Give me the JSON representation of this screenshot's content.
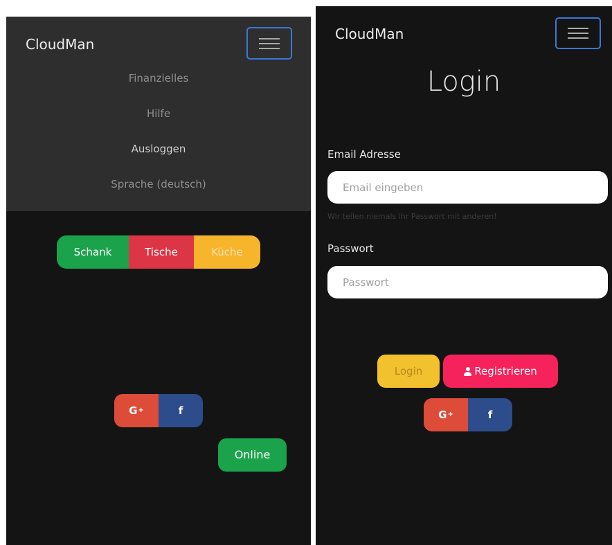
{
  "left_screen": {
    "navbar": {
      "brand": "CloudMan",
      "menu_items": [
        {
          "label": "Finanzielles",
          "active": false
        },
        {
          "label": "Hilfe",
          "active": false
        },
        {
          "label": "Ausloggen",
          "active": true
        },
        {
          "label": "Sprache (deutsch)",
          "active": false
        }
      ],
      "toggler_icon": "hamburger-icon"
    },
    "segmented_buttons": [
      {
        "label": "Schank",
        "color": "#1aa34a"
      },
      {
        "label": "Tische",
        "color": "#dc3545"
      },
      {
        "label": "Küche",
        "color": "#f7b52b"
      }
    ],
    "social": {
      "google_plus_label": "G",
      "google_plus_suffix": "+",
      "facebook_label": "f"
    },
    "online_button": {
      "label": "Online",
      "color": "#1aa34a"
    }
  },
  "right_screen": {
    "navbar": {
      "brand": "CloudMan",
      "toggler_icon": "hamburger-icon"
    },
    "title": "Login",
    "email": {
      "label": "Email Adresse",
      "placeholder": "Email eingeben",
      "value": "",
      "help": "Wir teilen niemals ihr Passwort mit anderen!"
    },
    "password": {
      "label": "Passwort",
      "placeholder": "Passwort",
      "value": ""
    },
    "login_button": {
      "label": "Login",
      "color": "#f2c12e"
    },
    "register_button": {
      "label": "Registrieren",
      "icon": "user-icon",
      "color": "#f5225b"
    },
    "social": {
      "google_plus_label": "G",
      "google_plus_suffix": "+",
      "facebook_label": "f"
    }
  },
  "colors": {
    "panel_bg": "#141414",
    "navbar_bg": "#2e2e2e",
    "toggler_border": "#3a78d8",
    "google_plus": "#dd4b39",
    "facebook": "#2d4c8c"
  }
}
